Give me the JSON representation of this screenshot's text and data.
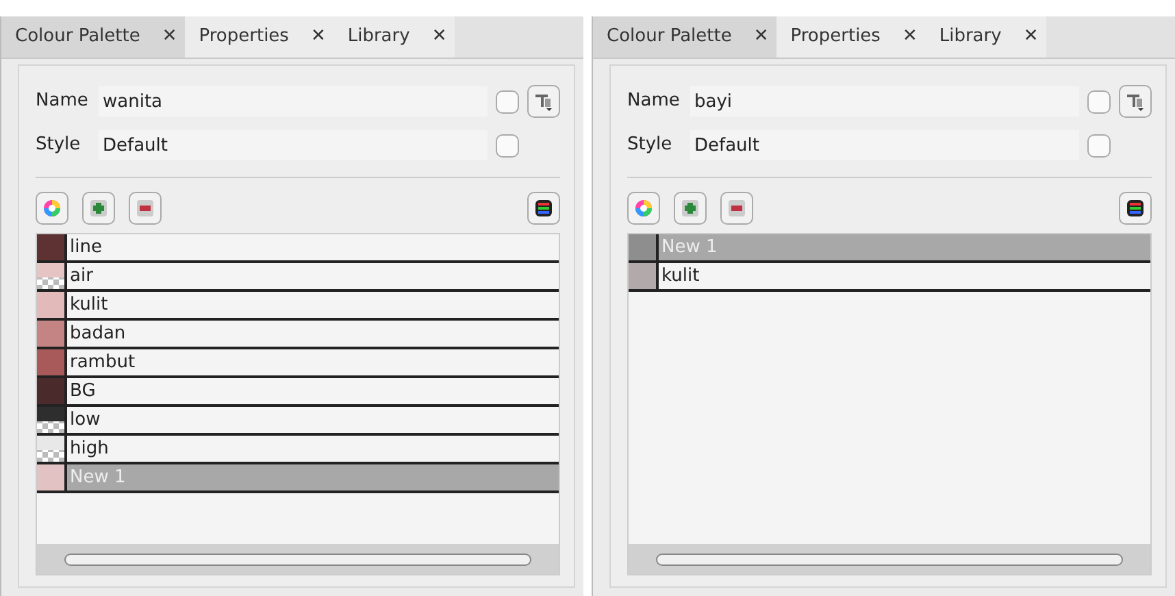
{
  "panels": [
    {
      "tabs": [
        {
          "label": "Colour Palette",
          "close": "✕",
          "selected": true
        },
        {
          "label": "Properties",
          "close": "✕",
          "selected": false
        },
        {
          "label": "Library",
          "close": "✕",
          "selected": false
        }
      ],
      "fields": [
        {
          "label": "Name",
          "value": "wanita",
          "checked": false,
          "menu_button": true
        },
        {
          "label": "Style",
          "value": "Default",
          "checked": false,
          "menu_button": false
        }
      ],
      "swatches": [
        {
          "name": "line",
          "color": "#5e3232",
          "transparent": false,
          "selected": false
        },
        {
          "name": "air",
          "color": "#e6c4c4",
          "transparent": true,
          "selected": false
        },
        {
          "name": "kulit",
          "color": "#e2baba",
          "transparent": false,
          "selected": false
        },
        {
          "name": "badan",
          "color": "#c48484",
          "transparent": false,
          "selected": false
        },
        {
          "name": "rambut",
          "color": "#a85a5a",
          "transparent": false,
          "selected": false
        },
        {
          "name": "BG",
          "color": "#4a2a2a",
          "transparent": false,
          "selected": false
        },
        {
          "name": "low",
          "color": "#2e2e2e",
          "transparent": true,
          "selected": false
        },
        {
          "name": "high",
          "color": "#e8e8e8",
          "transparent": true,
          "selected": false
        },
        {
          "name": "New 1",
          "color": "#e2c2c2",
          "transparent": false,
          "selected": true
        }
      ]
    },
    {
      "tabs": [
        {
          "label": "Colour Palette",
          "close": "✕",
          "selected": true
        },
        {
          "label": "Properties",
          "close": "✕",
          "selected": false
        },
        {
          "label": "Library",
          "close": "✕",
          "selected": false
        }
      ],
      "fields": [
        {
          "label": "Name",
          "value": "bayi",
          "checked": false,
          "menu_button": true
        },
        {
          "label": "Style",
          "value": "Default",
          "checked": false,
          "menu_button": false
        }
      ],
      "swatches": [
        {
          "name": "New 1",
          "color": "#8e8e8e",
          "transparent": false,
          "selected": true
        },
        {
          "name": "kulit",
          "color": "#b2aaaa",
          "transparent": false,
          "selected": false
        }
      ]
    }
  ]
}
